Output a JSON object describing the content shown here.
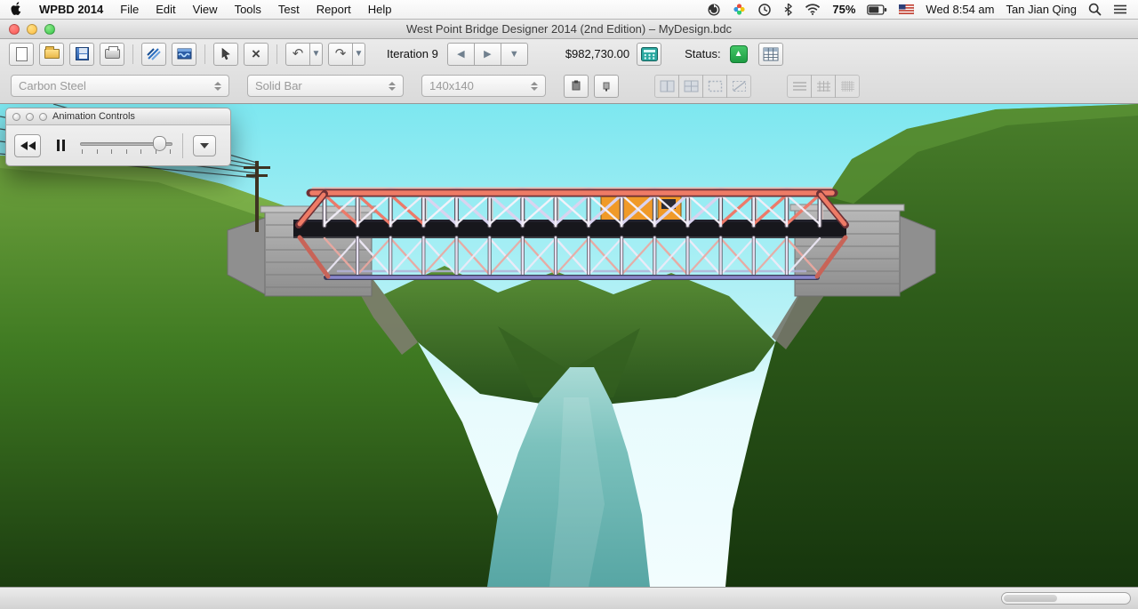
{
  "menubar": {
    "app_name": "WPBD 2014",
    "items": [
      "File",
      "Edit",
      "View",
      "Tools",
      "Test",
      "Report",
      "Help"
    ],
    "battery": "75%",
    "clock": "Wed 8:54 am",
    "user": "Tan Jian Qing"
  },
  "titlebar": {
    "title": "West Point Bridge Designer 2014 (2nd Edition) – MyDesign.bdc"
  },
  "toolbar": {
    "iteration": "Iteration 9",
    "cost": "$982,730.00",
    "status_label": "Status:"
  },
  "selectors": {
    "material": "Carbon Steel",
    "section": "Solid Bar",
    "size": "140x140"
  },
  "palette": {
    "title": "Animation Controls"
  },
  "icons": {
    "undo": "↶",
    "redo": "↷",
    "back": "◀",
    "forward": "▶",
    "down": "▼",
    "delete": "×",
    "up_arrow": "▲"
  },
  "colors": {
    "status_green": "#1d9c43",
    "calculator_teal": "#2aa8a0",
    "sky": "#7de7f0",
    "river": "#57a6a4"
  }
}
